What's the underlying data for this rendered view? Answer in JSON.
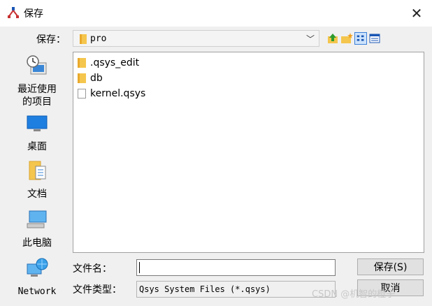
{
  "window": {
    "title": "保存",
    "close_glyph": "✕"
  },
  "toolbar": {
    "save_in_label": "保存：",
    "current_folder": "pro",
    "dropdown_glyph": "﹀"
  },
  "places": [
    {
      "label": "最近使用\n的项目",
      "icon": "recent-items-icon"
    },
    {
      "label": "桌面",
      "icon": "desktop-icon"
    },
    {
      "label": "文档",
      "icon": "documents-icon"
    },
    {
      "label": "此电脑",
      "icon": "computer-icon"
    },
    {
      "label": "Network",
      "icon": "network-icon"
    }
  ],
  "files": [
    {
      "name": ".qsys_edit",
      "type": "folder"
    },
    {
      "name": "db",
      "type": "folder"
    },
    {
      "name": "kernel.qsys",
      "type": "file"
    }
  ],
  "form": {
    "filename_label": "文件名：",
    "filename_value": "",
    "filetype_label": "文件类型：",
    "filetype_value": "Qsys System Files (*.qsys)",
    "save_button": "保存(S)",
    "cancel_button": "取消"
  },
  "watermark": "CSDN @机智的橙子",
  "colors": {
    "folder": "#f5c64d",
    "accent": "#3b7fd8"
  }
}
